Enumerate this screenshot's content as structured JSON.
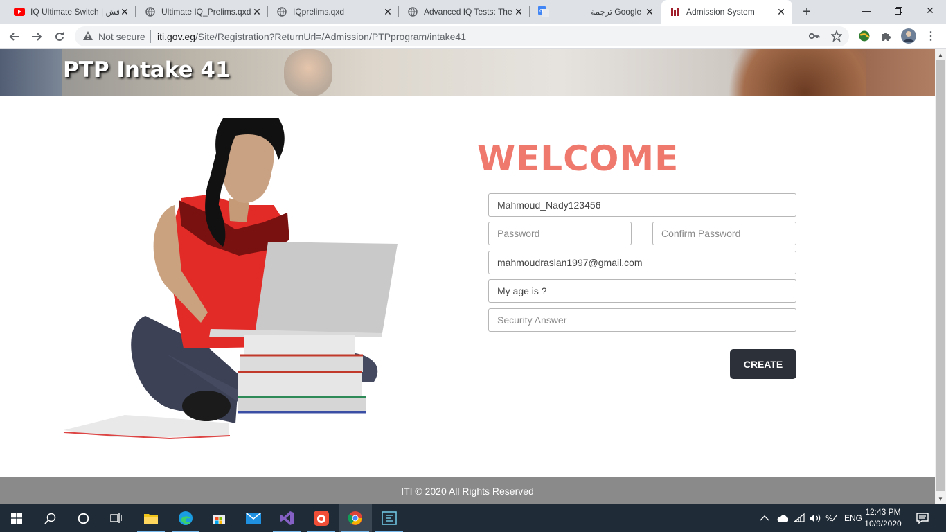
{
  "browser": {
    "tabs": [
      {
        "title": "IQ Ultimate Switch | فش",
        "icon": "youtube-icon"
      },
      {
        "title": "Ultimate IQ_Prelims.qxd",
        "icon": "globe-icon"
      },
      {
        "title": "IQprelims.qxd",
        "icon": "globe-icon"
      },
      {
        "title": "Advanced IQ Tests: The",
        "icon": "globe-icon"
      },
      {
        "title": "ترجمة Google",
        "icon": "google-translate-icon"
      },
      {
        "title": "Admission System",
        "icon": "iti-icon",
        "active": true
      }
    ],
    "security_label": "Not secure",
    "url_host": "iti.gov.eg",
    "url_path": "/Site/Registration?ReturnUrl=/Admission/PTPprogram/intake41"
  },
  "page": {
    "banner_title": "PTP Intake 41",
    "welcome": "WELCOME",
    "form": {
      "username_value": "Mahmoud_Nady123456",
      "password_placeholder": "Password",
      "confirm_placeholder": "Confirm Password",
      "email_value": "mahmoudraslan1997@gmail.com",
      "question_value": "My age is ?",
      "answer_placeholder": "Security Answer",
      "create_label": "CREATE"
    },
    "footer": "ITI © 2020 All Rights Reserved"
  },
  "taskbar": {
    "language": "ENG",
    "time": "12:43 PM",
    "date": "10/9/2020"
  },
  "colors": {
    "welcome": "#f0796e",
    "button": "#2c3139",
    "footer": "#8a8a8a"
  }
}
